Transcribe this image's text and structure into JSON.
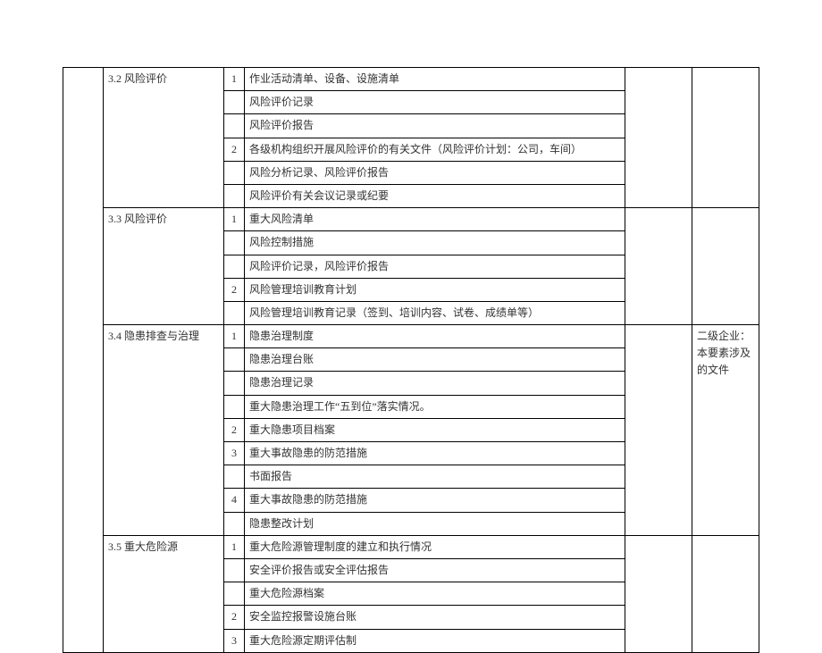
{
  "sections": {
    "s32": {
      "title": "3.2 风险评价",
      "rows": [
        {
          "n": "1",
          "t": "作业活动清单、设备、设施清单"
        },
        {
          "n": "",
          "t": "风险评价记录"
        },
        {
          "n": "",
          "t": "风险评价报告"
        },
        {
          "n": "2",
          "t": "各级机构组织开展风险评价的有关文件（风险评价计划：公司，车间）"
        },
        {
          "n": "",
          "t": "风险分析记录、风险评价报告"
        },
        {
          "n": "",
          "t": "风险评价有关会议记录或纪要"
        }
      ]
    },
    "s33": {
      "title": "3.3 风险评价",
      "rows": [
        {
          "n": "1",
          "t": "重大风险清单"
        },
        {
          "n": "",
          "t": "风险控制措施"
        },
        {
          "n": "",
          "t": "风险评价记录，风险评价报告"
        },
        {
          "n": "2",
          "t": "风险管理培训教育计划"
        },
        {
          "n": "",
          "t": "风险管理培训教育记录（签到、培训内容、试卷、成绩单等）"
        }
      ]
    },
    "s34": {
      "title": "3.4 隐患排查与治理",
      "note": "二级企业：本要素涉及的文件",
      "rows": [
        {
          "n": "1",
          "t": "隐患治理制度"
        },
        {
          "n": "",
          "t": "隐患治理台账"
        },
        {
          "n": "",
          "t": "隐患治理记录"
        },
        {
          "n": "",
          "t": "重大隐患治理工作“五到位”落实情况。"
        },
        {
          "n": "2",
          "t": "重大隐患项目档案"
        },
        {
          "n": "3",
          "t": "重大事故隐患的防范措施"
        },
        {
          "n": "",
          "t": "书面报告"
        },
        {
          "n": "4",
          "t": "重大事故隐患的防范措施"
        },
        {
          "n": "",
          "t": "隐患整改计划"
        }
      ]
    },
    "s35": {
      "title": "3.5 重大危险源",
      "rows": [
        {
          "n": "1",
          "t": "重大危险源管理制度的建立和执行情况"
        },
        {
          "n": "",
          "t": "安全评价报告或安全评估报告"
        },
        {
          "n": "",
          "t": "重大危险源档案"
        },
        {
          "n": "2",
          "t": "安全监控报警设施台账"
        },
        {
          "n": "3",
          "t": "重大危险源定期评估制"
        }
      ]
    }
  }
}
